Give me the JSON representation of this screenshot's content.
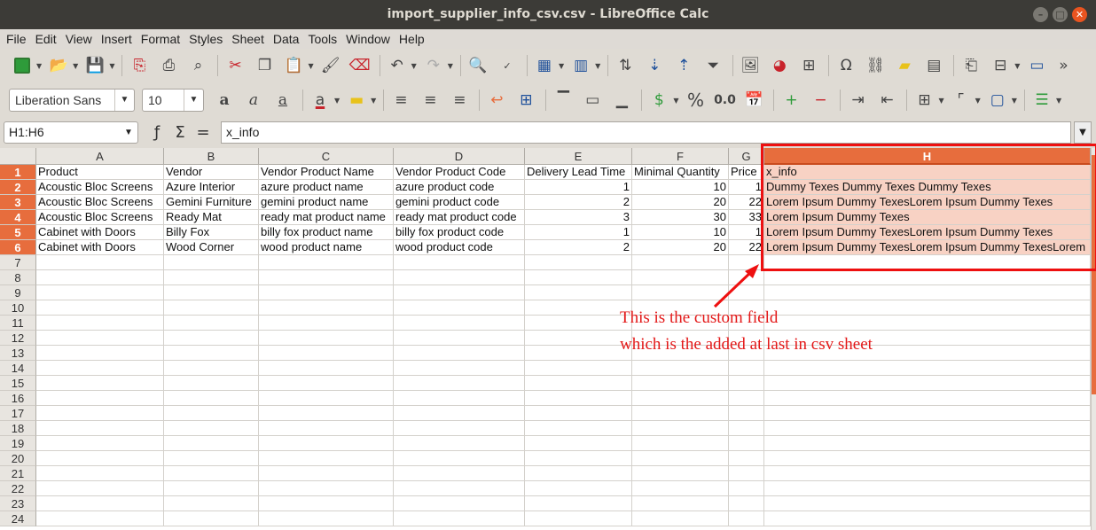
{
  "window": {
    "title": "import_supplier_info_csv.csv - LibreOffice Calc",
    "controls": [
      "–",
      "□",
      "✕"
    ]
  },
  "menu": [
    "File",
    "Edit",
    "View",
    "Insert",
    "Format",
    "Styles",
    "Sheet",
    "Data",
    "Tools",
    "Window",
    "Help"
  ],
  "format_bar": {
    "font_name": "Liberation Sans",
    "font_size": "10",
    "percent_label": "%",
    "number_format_label": "0.0"
  },
  "formula_bar": {
    "name_box": "H1:H6",
    "content": "x_info"
  },
  "columns": [
    "A",
    "B",
    "C",
    "D",
    "E",
    "F",
    "G",
    "H"
  ],
  "rows": [
    "1",
    "2",
    "3",
    "4",
    "5",
    "6",
    "7",
    "8",
    "9",
    "10",
    "11",
    "12",
    "13",
    "14",
    "15",
    "16",
    "17",
    "18",
    "19",
    "20",
    "21",
    "22",
    "23",
    "24"
  ],
  "sheet": {
    "header": [
      "Product",
      "Vendor",
      "Vendor Product Name",
      "Vendor Product Code",
      "Delivery Lead Time",
      "Minimal Quantity",
      "Price",
      "x_info"
    ],
    "data": [
      [
        "Acoustic Bloc Screens",
        "Azure Interior",
        "azure product name",
        "azure product code",
        "1",
        "10",
        "1",
        "Dummy Texes Dummy Texes Dummy Texes"
      ],
      [
        "Acoustic Bloc Screens",
        "Gemini Furniture",
        "gemini product name",
        "gemini product code",
        "2",
        "20",
        "22",
        " Lorem Ipsum Dummy TexesLorem Ipsum Dummy Texes"
      ],
      [
        "Acoustic Bloc Screens",
        "Ready Mat",
        "ready mat product name",
        "ready mat product code",
        "3",
        "30",
        "33",
        "Lorem Ipsum Dummy Texes"
      ],
      [
        "Cabinet with Doors",
        "Billy Fox",
        "billy fox product name",
        "billy fox product code",
        "1",
        "10",
        "1",
        "Lorem Ipsum Dummy TexesLorem Ipsum Dummy Texes"
      ],
      [
        "Cabinet with Doors",
        "Wood Corner",
        "wood product name",
        "wood product code",
        "2",
        "20",
        "22",
        "Lorem Ipsum Dummy TexesLorem Ipsum Dummy TexesLorem"
      ]
    ]
  },
  "annotation": {
    "line1": "This is the custom field",
    "line2": "which is the added at last in csv sheet",
    "color": "#e31818"
  },
  "selection_color": "#e76d3d"
}
